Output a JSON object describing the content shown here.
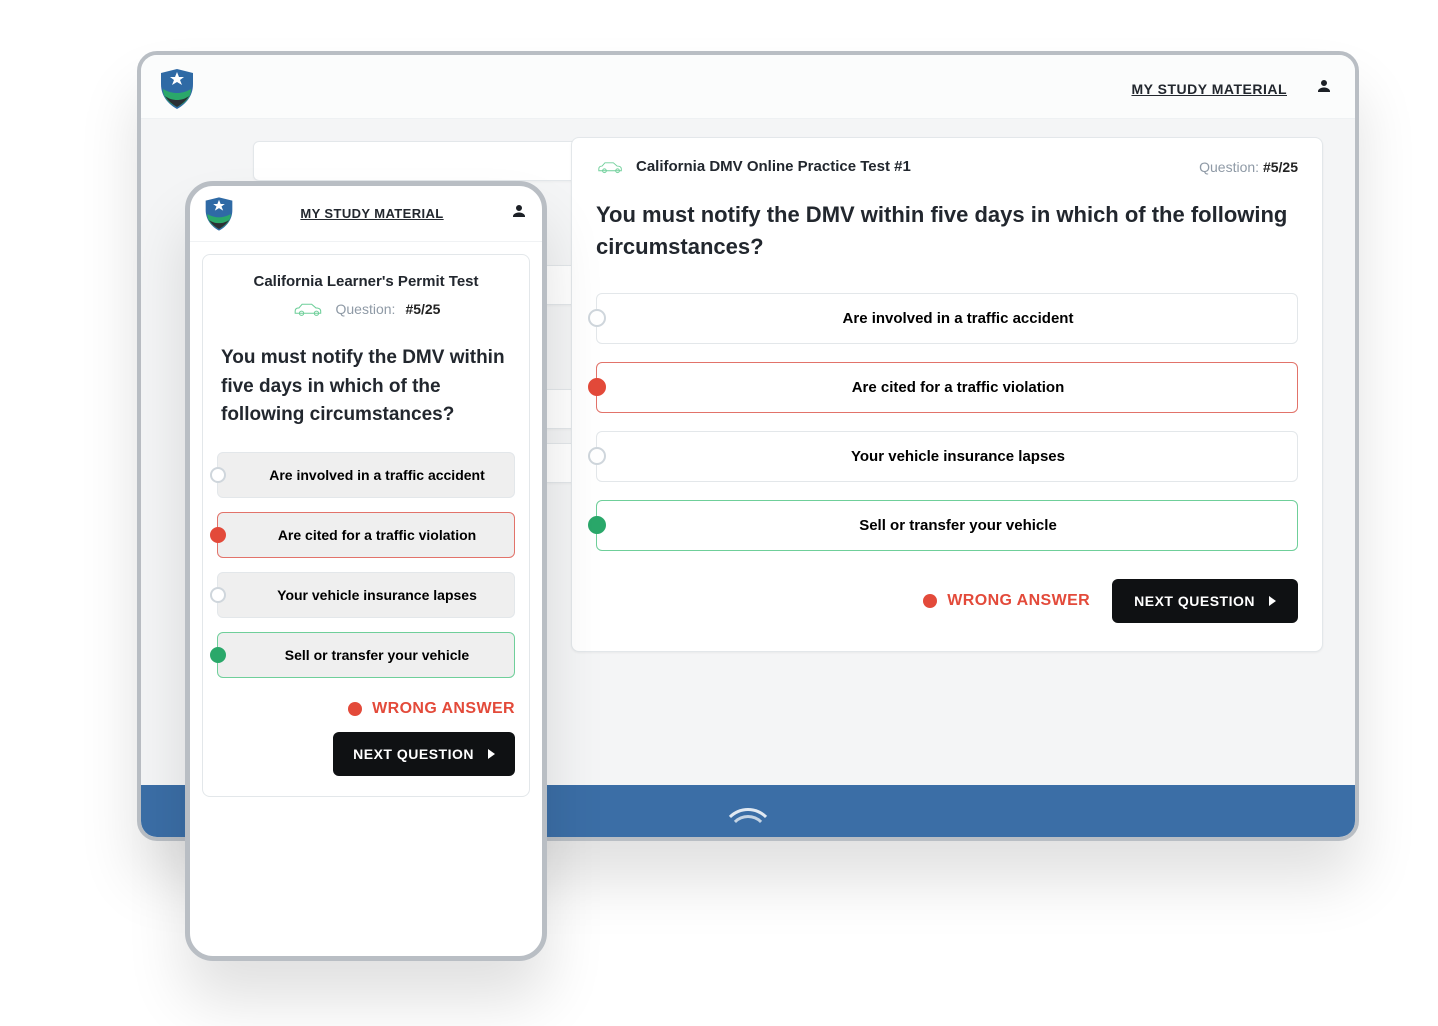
{
  "nav": {
    "study_link": "MY STUDY MATERIAL"
  },
  "desktop": {
    "test_title": "California DMV Online Practice Test #1",
    "question_label": "Question:",
    "question_counter": "#5/25",
    "question_text": "You must notify the DMV within five days in which of the following circumstances?",
    "answers": [
      {
        "text": "Are involved in a traffic accident",
        "state": "neutral"
      },
      {
        "text": "Are cited for a traffic violation",
        "state": "wrong"
      },
      {
        "text": "Your vehicle insurance lapses",
        "state": "neutral"
      },
      {
        "text": "Sell or transfer your vehicle",
        "state": "correct"
      }
    ],
    "wrong_label": "WRONG ANSWER",
    "next_button": "NEXT QUESTION"
  },
  "phone": {
    "test_title": "California Learner's Permit Test",
    "question_label": "Question:",
    "question_counter": "#5/25",
    "question_text": "You must notify the DMV within five days in which of the following circumstances?",
    "answers": [
      {
        "text": "Are involved in a traffic accident",
        "state": "neutral"
      },
      {
        "text": "Are cited for a traffic violation",
        "state": "wrong"
      },
      {
        "text": "Your vehicle insurance lapses",
        "state": "neutral"
      },
      {
        "text": "Sell or transfer your vehicle",
        "state": "correct"
      }
    ],
    "wrong_label": "WRONG ANSWER",
    "next_button": "NEXT QUESTION"
  }
}
